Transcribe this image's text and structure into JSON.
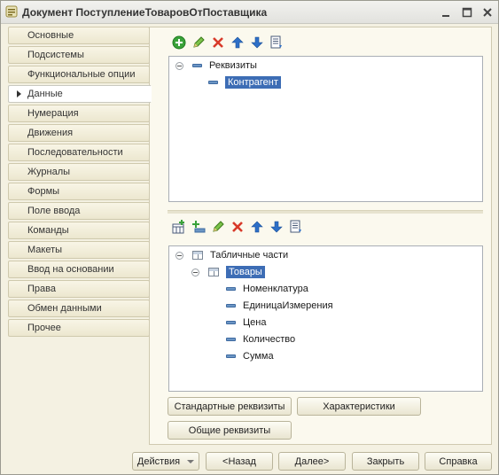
{
  "window": {
    "title": "Документ ПоступлениеТоваровОтПоставщика",
    "controls": {
      "minimize": "_",
      "maximize": "□",
      "close": "✕"
    }
  },
  "tabs": [
    {
      "label": "Основные"
    },
    {
      "label": "Подсистемы"
    },
    {
      "label": "Функциональные опции"
    },
    {
      "label": "Данные",
      "active": true
    },
    {
      "label": "Нумерация"
    },
    {
      "label": "Движения"
    },
    {
      "label": "Последовательности"
    },
    {
      "label": "Журналы"
    },
    {
      "label": "Формы"
    },
    {
      "label": "Поле ввода"
    },
    {
      "label": "Команды"
    },
    {
      "label": "Макеты"
    },
    {
      "label": "Ввод на основании"
    },
    {
      "label": "Права"
    },
    {
      "label": "Обмен данными"
    },
    {
      "label": "Прочее"
    }
  ],
  "attributes_tree": {
    "root": "Реквизиты",
    "items": [
      "Контрагент"
    ],
    "selected": "Контрагент"
  },
  "tabular_tree": {
    "root": "Табличные части",
    "parts": [
      {
        "name": "Товары",
        "columns": [
          "Номенклатура",
          "ЕдиницаИзмерения",
          "Цена",
          "Количество",
          "Сумма"
        ]
      }
    ]
  },
  "buttons": {
    "standard_attributes": "Стандартные реквизиты",
    "characteristics": "Характеристики",
    "common_attributes": "Общие реквизиты"
  },
  "footer": {
    "actions": "Действия",
    "back": "<Назад",
    "next": "Далее>",
    "close": "Закрыть",
    "help": "Справка"
  },
  "colors": {
    "selection": "#3d6db5",
    "add": "#3aa23a",
    "delete": "#d83a2a",
    "arrows": "#2d6fc7"
  }
}
